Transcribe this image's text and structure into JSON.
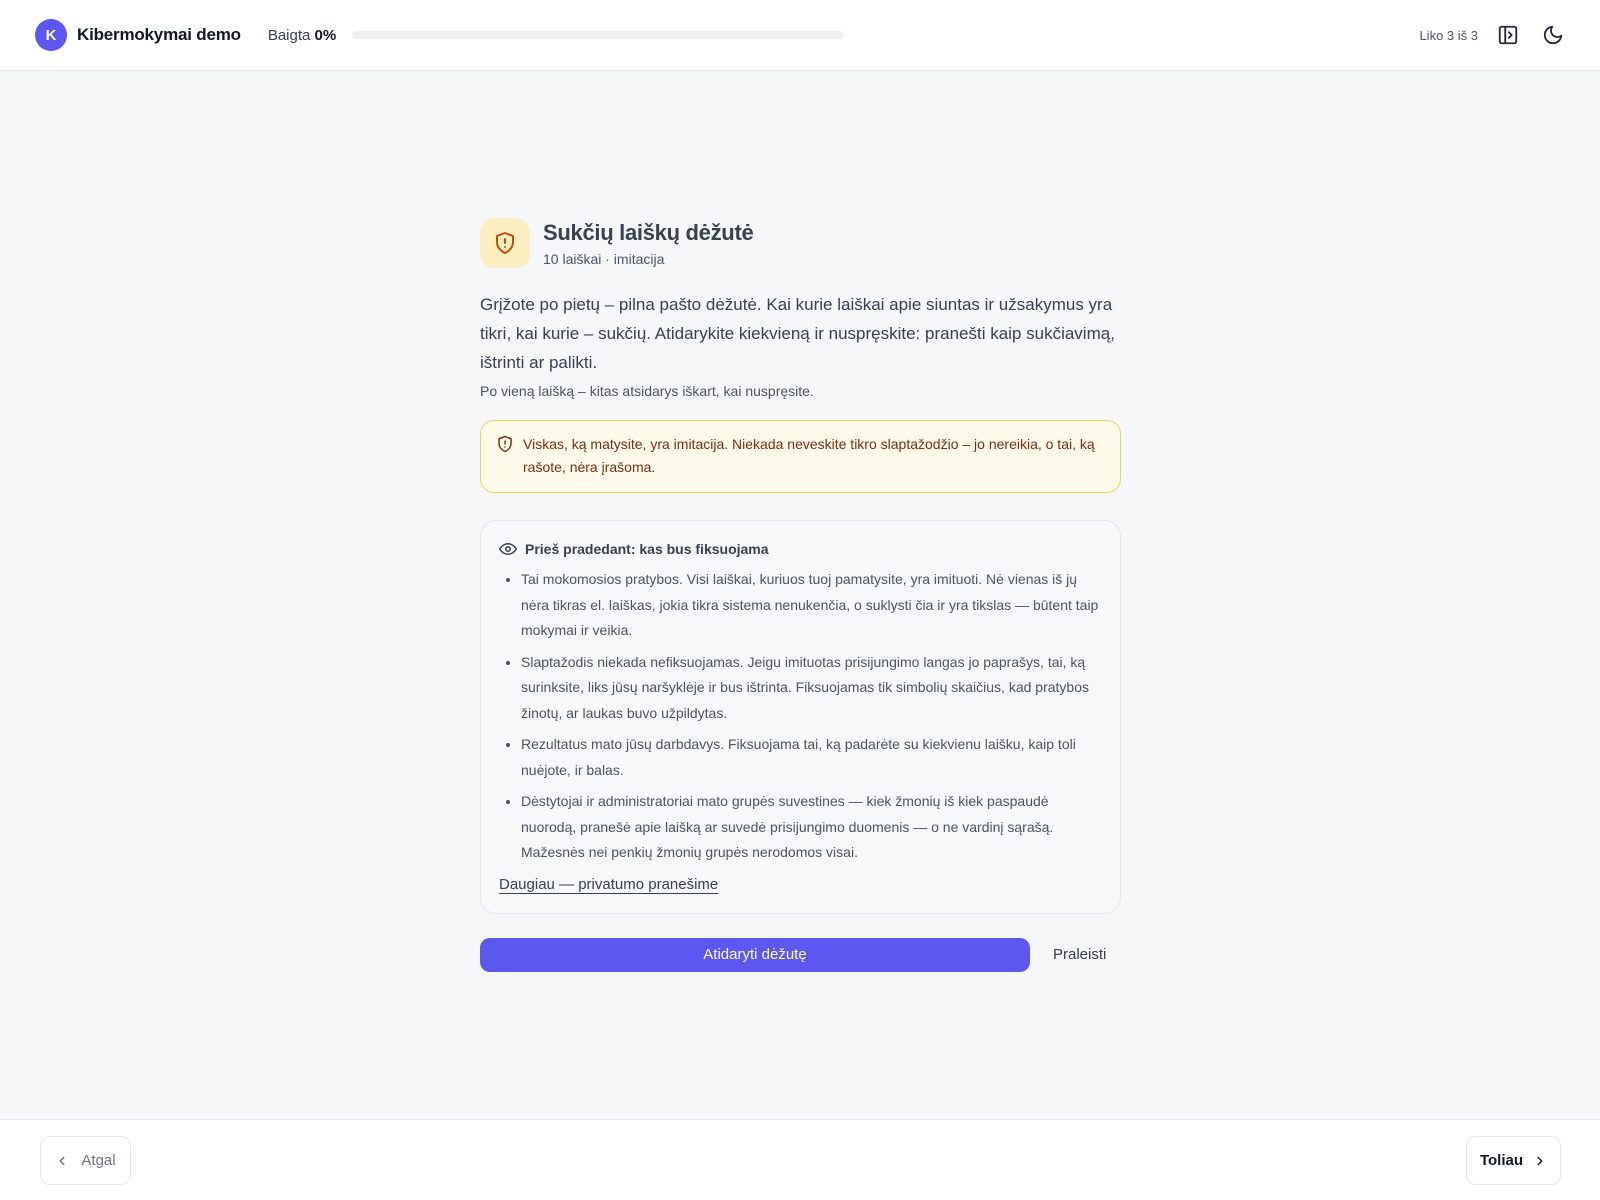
{
  "header": {
    "logo_letter": "K",
    "app_title": "Kibermokymai demo",
    "progress_label": "Baigta",
    "progress_value": "0%",
    "progress_fraction": 0,
    "remaining": "Liko 3 iš 3"
  },
  "scenario": {
    "title": "Sukčių laiškų dėžutė",
    "subtitle": "10 laiškai · imitacija",
    "lead": "Grįžote po pietų – pilna pašto dėžutė. Kai kurie laiškai apie siuntas ir užsakymus yra tikri, kai kurie – sukčių. Atidarykite kiekvieną ir nuspręskite: pranešti kaip sukčiavimą, ištrinti ar palikti.",
    "note": "Po vieną laišką – kitas atsidarys iškart, kai nuspręsite.",
    "warning": "Viskas, ką matysite, yra imitacija. Niekada neveskite tikro slaptažodžio – jo nereikia, o tai, ką rašote, nėra įrašoma."
  },
  "info": {
    "heading": "Prieš pradedant: kas bus fiksuojama",
    "items": [
      "Tai mokomosios pratybos. Visi laiškai, kuriuos tuoj pamatysite, yra imituoti. Nė vienas iš jų nėra tikras el. laiškas, jokia tikra sistema nenukenčia, o suklysti čia ir yra tikslas — būtent taip mokymai ir veikia.",
      "Slaptažodis niekada nefiksuojamas. Jeigu imituotas prisijungimo langas jo paprašys, tai, ką surinksite, liks jūsų naršyklėje ir bus ištrinta. Fiksuojamas tik simbolių skaičius, kad pratybos žinotų, ar laukas buvo užpildytas.",
      "Rezultatus mato jūsų darbdavys. Fiksuojama tai, ką padarėte su kiekvienu laišku, kaip toli nuėjote, ir balas.",
      "Dėstytojai ir administratoriai mato grupės suvestines — kiek žmonių iš kiek paspaudė nuorodą, pranešė apie laišką ar suvedė prisijungimo duomenis — o ne vardinį sąrašą. Mažesnės nei penkių žmonių grupės nerodomos visai."
    ],
    "link": "Daugiau — privatumo pranešime"
  },
  "actions": {
    "primary": "Atidaryti dėžutę",
    "skip": "Praleisti"
  },
  "footer": {
    "back": "Atgal",
    "next": "Toliau"
  },
  "colors": {
    "accent": "#5b57f0",
    "warning_border": "#f3cf5b",
    "warning_bg": "#fefaea",
    "warning_text": "#7a2d12",
    "badge_bg": "#fdeec2"
  }
}
